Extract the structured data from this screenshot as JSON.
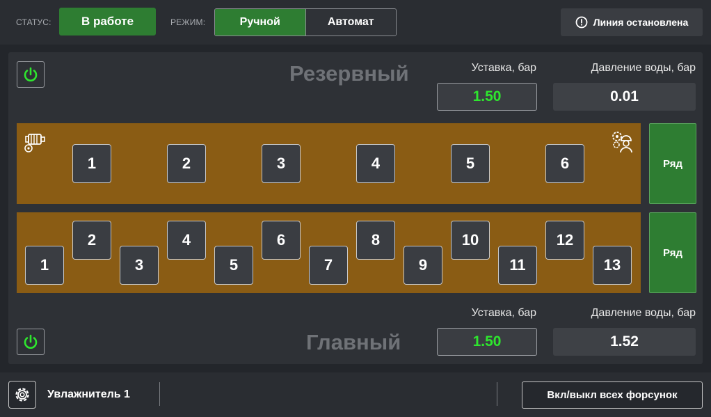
{
  "header": {
    "status_label": "СТАТУС:",
    "status_value": "В работе",
    "mode_label": "РЕЖИМ:",
    "mode_manual": "Ручной",
    "mode_auto": "Автомат",
    "line_status": "Линия остановлена"
  },
  "reserve": {
    "title": "Резервный",
    "setpoint_label": "Уставка, бар",
    "setpoint_value": "1.50",
    "pressure_label": "Давление воды, бар",
    "pressure_value": "0.01",
    "row_button": "Ряд",
    "nozzles": [
      "1",
      "2",
      "3",
      "4",
      "5",
      "6"
    ]
  },
  "main": {
    "title": "Главный",
    "setpoint_label": "Уставка, бар",
    "setpoint_value": "1.50",
    "pressure_label": "Давление воды, бар",
    "pressure_value": "1.52",
    "row_button": "Ряд",
    "nozzles": [
      "1",
      "2",
      "3",
      "4",
      "5",
      "6",
      "7",
      "8",
      "9",
      "10",
      "11",
      "12",
      "13"
    ]
  },
  "footer": {
    "device_name": "Увлажнитель 1",
    "toggle_all": "Вкл/выкл всех форсунок"
  },
  "colors": {
    "accent_green": "#2e7d32",
    "value_green": "#2ee62e",
    "strip_brown": "#8a5c14"
  },
  "icons": [
    "power-icon",
    "motor-icon",
    "engineer-icon",
    "alert-circle-icon",
    "gear-icon"
  ]
}
